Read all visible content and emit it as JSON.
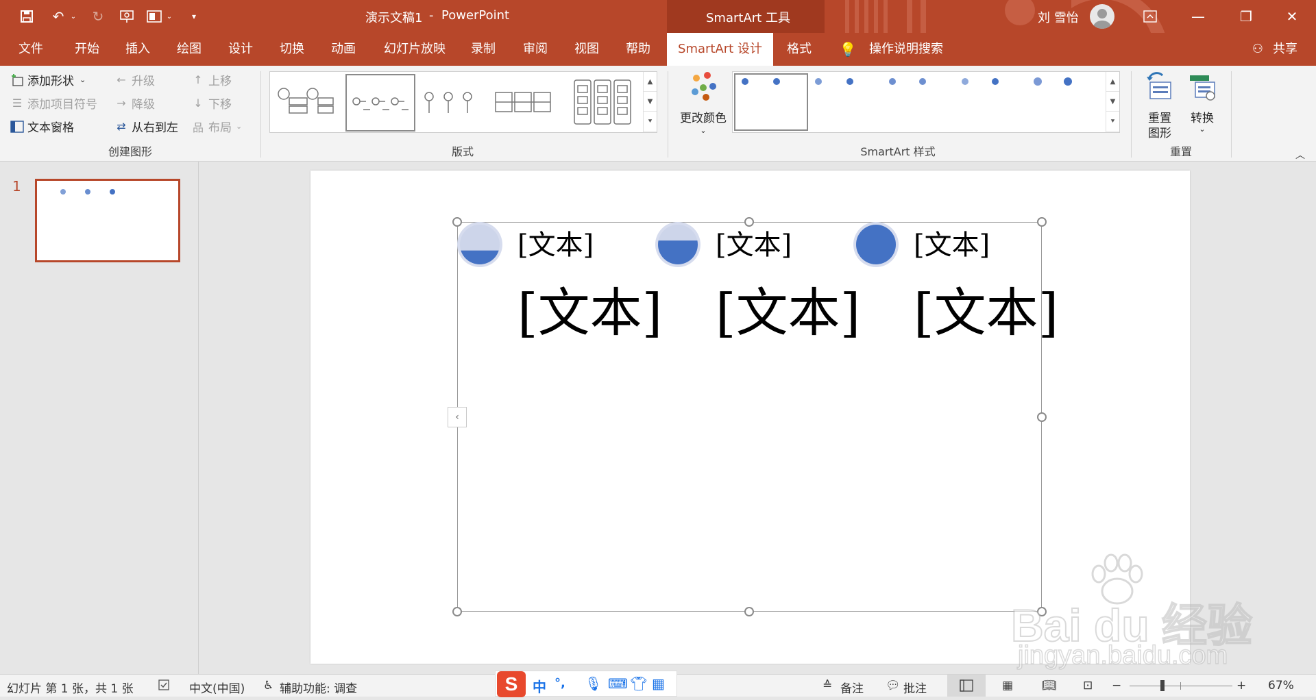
{
  "window": {
    "title": "演示文稿1",
    "title_sep": "-",
    "app": "PowerPoint",
    "context_tool": "SmartArt 工具",
    "user": "刘 雪怡"
  },
  "tabs": [
    "文件",
    "开始",
    "插入",
    "绘图",
    "设计",
    "切换",
    "动画",
    "幻灯片放映",
    "录制",
    "审阅",
    "视图",
    "帮助",
    "SmartArt 设计",
    "格式"
  ],
  "active_tab": "SmartArt 设计",
  "tell_me": "操作说明搜索",
  "share": "共享",
  "ribbon": {
    "create_graphic": {
      "add_shape": "添加形状",
      "add_bullet": "添加项目符号",
      "text_pane": "文本窗格",
      "promote": "升级",
      "demote": "降级",
      "rtl": "从右到左",
      "move_up": "上移",
      "move_down": "下移",
      "layout": "布局",
      "label": "创建图形"
    },
    "layouts_label": "版式",
    "change_colors": "更改颜色",
    "styles_label": "SmartArt 样式",
    "reset_graphic_1": "重置",
    "reset_graphic_2": "图形",
    "convert": "转换",
    "reset_label": "重置"
  },
  "thumbnail": {
    "number": "1"
  },
  "slide": {
    "header_text": [
      "[文本]",
      "[文本]",
      "[文本]"
    ],
    "body_text": [
      "[文本]",
      "[文本]",
      "[文本]"
    ],
    "circle_fill_levels": [
      0.35,
      0.6,
      1.0
    ],
    "accent_color": "#4472c4",
    "light_color": "#cdd5ea"
  },
  "status": {
    "slide_info": "幻灯片 第 1 张，共 1 张",
    "language": "中文(中国)",
    "accessibility": "辅助功能: 调查",
    "notes": "备注",
    "comments": "批注",
    "zoom": "67%",
    "ime_chars": [
      "中",
      "°,"
    ]
  },
  "watermark": {
    "brand": "Bai du 经验",
    "url": "jingyan.baidu.com"
  },
  "colors": {
    "ribbon_accent": "#b7472a",
    "context_band": "#a0391f"
  }
}
